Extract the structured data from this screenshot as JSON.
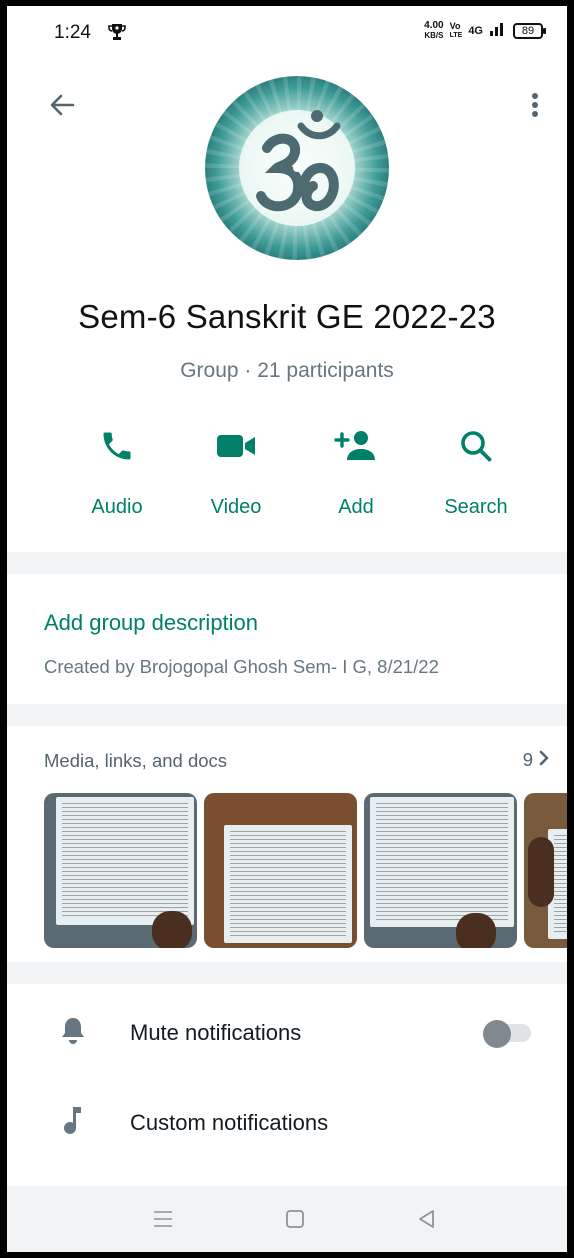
{
  "status_bar": {
    "time": "1:24",
    "speed_value": "4.00",
    "speed_unit": "KB/S",
    "volte_top": "Vo",
    "volte_bottom": "LTE",
    "network": "4G",
    "battery": "89"
  },
  "group": {
    "name": "Sem-6 Sanskrit GE 2022-23",
    "subtitle": "Group · 21 participants"
  },
  "actions": [
    {
      "label": "Audio",
      "icon": "phone-icon"
    },
    {
      "label": "Video",
      "icon": "video-camera-icon"
    },
    {
      "label": "Add",
      "icon": "add-person-icon"
    },
    {
      "label": "Search",
      "icon": "search-icon"
    }
  ],
  "description": {
    "add_label": "Add group description",
    "created": "Created by Brojogopal Ghosh Sem- I G, 8/21/22"
  },
  "media": {
    "title": "Media, links, and docs",
    "count": "9"
  },
  "settings": {
    "mute_label": "Mute notifications",
    "mute_enabled": false,
    "custom_label": "Custom notifications"
  },
  "colors": {
    "accent": "#008069",
    "muted_text": "#667781"
  }
}
